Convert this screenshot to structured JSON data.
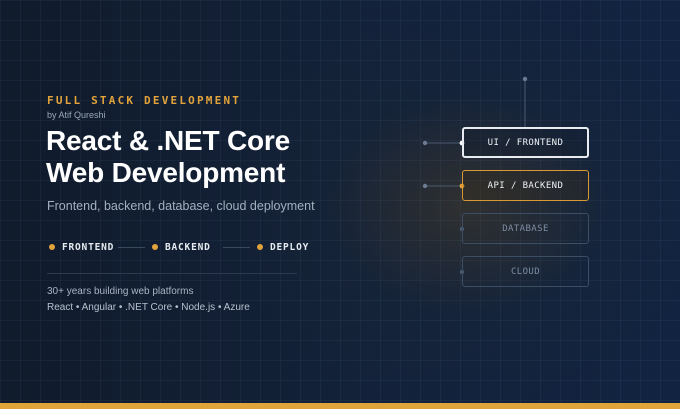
{
  "hero": {
    "eyebrow": "FULL STACK DEVELOPMENT",
    "author": "by Atif Qureshi",
    "title_line1": "React & .NET Core",
    "title_line2": "Web Development",
    "subtitle": "Frontend, backend, database, cloud deployment",
    "steps": [
      {
        "label": "FRONTEND"
      },
      {
        "label": "BACKEND"
      },
      {
        "label": "DEPLOY"
      }
    ],
    "note_line1": "30+ years building web platforms",
    "note_line2": "React • Angular • .NET Core • Node.js • Azure"
  },
  "diagram": {
    "nodes": [
      {
        "label": "UI / FRONTEND",
        "state": "active"
      },
      {
        "label": "API / BACKEND",
        "state": "highlighted"
      },
      {
        "label": "DATABASE",
        "state": "dimmed"
      },
      {
        "label": "CLOUD",
        "state": "dimmed"
      }
    ]
  },
  "colors": {
    "background": "#0f1c2e",
    "accent": "#e3a33b",
    "text_primary": "#ffffff",
    "text_muted": "#a3b0c0"
  }
}
